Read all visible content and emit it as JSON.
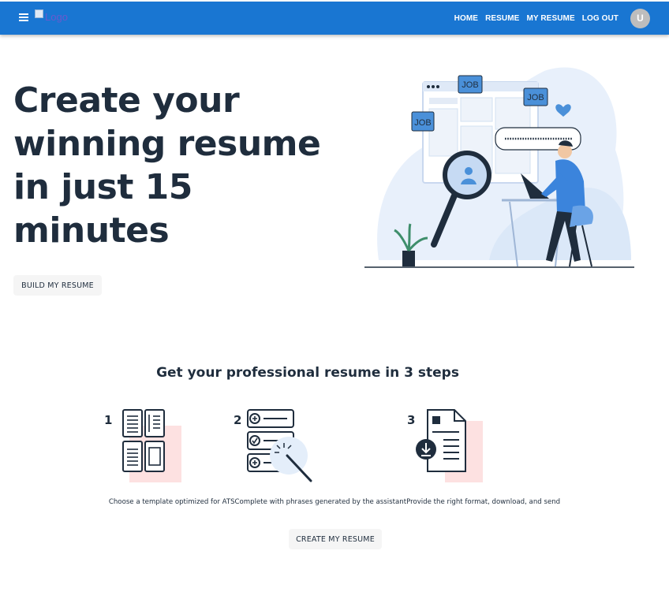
{
  "appbar": {
    "logo_alt": "Logo",
    "nav": [
      "HOME",
      "RESUME",
      "MY RESUME",
      "LOG OUT"
    ],
    "avatar_initial": "U",
    "color": "#1976d2"
  },
  "hero": {
    "title": "Create your winning resume in just 15 minutes",
    "cta": "BUILD MY RESUME",
    "illustration_labels": {
      "job_1": "JOB",
      "job_2": "JOB",
      "job_3": "JOB"
    }
  },
  "steps": {
    "title": "Get your professional resume in 3 steps",
    "items": [
      {
        "number": "1",
        "icon": "template-layout-icon"
      },
      {
        "number": "2",
        "icon": "magic-wand-list-icon"
      },
      {
        "number": "3",
        "icon": "document-download-icon"
      }
    ],
    "description": "Choose a template optimized for ATSComplete with phrases generated by the assistantProvide the right format, download, and send",
    "cta": "CREATE MY RESUME"
  }
}
